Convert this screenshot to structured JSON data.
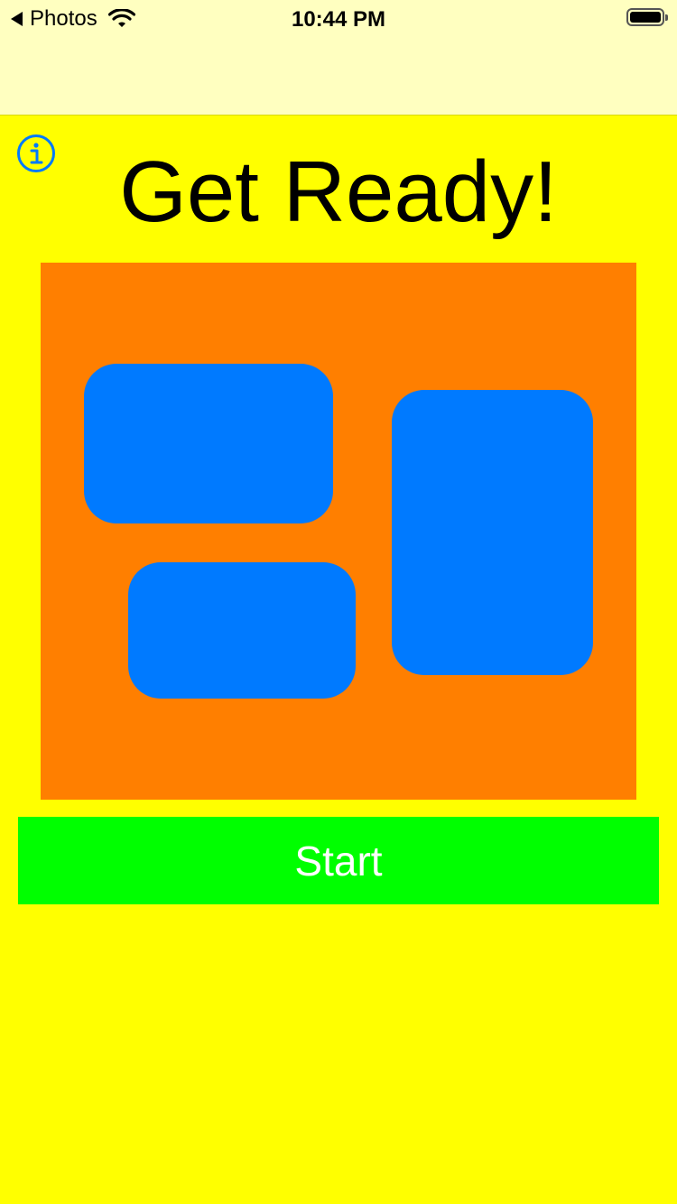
{
  "status_bar": {
    "back_label": "Photos",
    "time": "10:44 PM",
    "wifi_icon": "wifi-icon",
    "battery_icon": "battery-icon"
  },
  "header": {
    "info_icon": "info-circle-icon",
    "title": "Get Ready!"
  },
  "board": {
    "tiles": [
      {
        "name": "tile-1"
      },
      {
        "name": "tile-2"
      },
      {
        "name": "tile-3"
      }
    ]
  },
  "actions": {
    "start_label": "Start"
  },
  "colors": {
    "background": "#ffff00",
    "status_bar": "#ffffc0",
    "board": "#ff7f00",
    "tile": "#007aff",
    "start_button": "#00ff00",
    "info_icon": "#007aff"
  }
}
